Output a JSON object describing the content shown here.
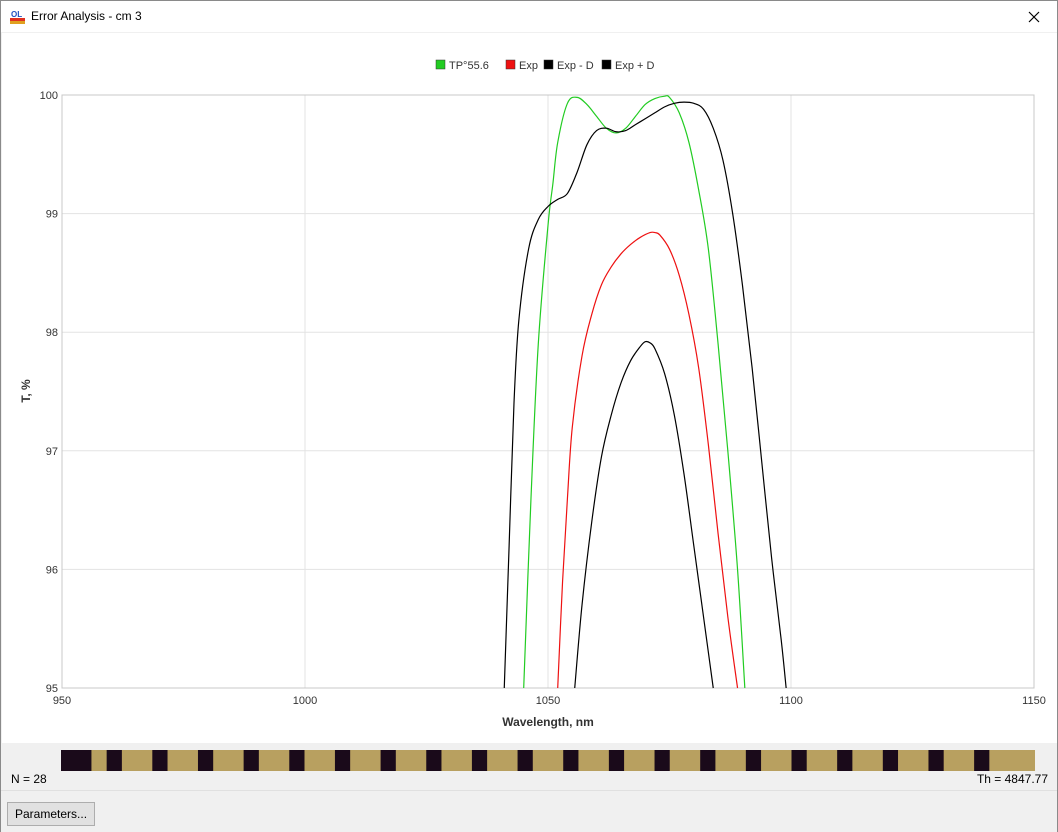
{
  "window": {
    "title": "Error Analysis - cm 3"
  },
  "legend": [
    {
      "label": "TP°55.6",
      "color": "#22cc22"
    },
    {
      "label": "Exp",
      "color": "#ee1111"
    },
    {
      "label": "Exp - D",
      "color": "#000000"
    },
    {
      "label": "Exp + D",
      "color": "#000000"
    }
  ],
  "chart_data": {
    "type": "line",
    "xlabel": "Wavelength, nm",
    "ylabel": "T, %",
    "xlim": [
      950,
      1150
    ],
    "ylim": [
      95,
      100
    ],
    "xticks": [
      950,
      1000,
      1050,
      1100,
      1150
    ],
    "yticks": [
      95,
      96,
      97,
      98,
      99,
      100
    ],
    "grid": true,
    "legend_position": "top-center",
    "series": [
      {
        "name": "TP°55.6",
        "color": "#22cc22",
        "x": [
          1045,
          1046.5,
          1048,
          1050,
          1051,
          1052,
          1054,
          1056,
          1058,
          1060,
          1062,
          1064,
          1066,
          1068,
          1070,
          1072,
          1074,
          1075,
          1077,
          1079,
          1081,
          1083,
          1085,
          1087,
          1089,
          1090.5
        ],
        "y": [
          95.0,
          96.6,
          97.9,
          98.9,
          99.25,
          99.6,
          99.93,
          99.98,
          99.92,
          99.82,
          99.72,
          99.68,
          99.72,
          99.82,
          99.92,
          99.97,
          99.99,
          99.98,
          99.85,
          99.6,
          99.2,
          98.7,
          97.9,
          97.0,
          96.0,
          95.0
        ]
      },
      {
        "name": "Exp",
        "color": "#ee1111",
        "x": [
          1052,
          1053,
          1054,
          1055,
          1057,
          1059,
          1061,
          1063,
          1065,
          1067,
          1069,
          1071,
          1072,
          1073,
          1075,
          1077,
          1079,
          1081,
          1083,
          1085,
          1087,
          1089
        ],
        "y": [
          95.0,
          95.9,
          96.6,
          97.2,
          97.8,
          98.15,
          98.4,
          98.55,
          98.66,
          98.74,
          98.8,
          98.84,
          98.84,
          98.82,
          98.7,
          98.48,
          98.15,
          97.7,
          97.05,
          96.3,
          95.6,
          95.0
        ]
      },
      {
        "name": "Exp - D",
        "color": "#000000",
        "x": [
          1055.5,
          1057,
          1059,
          1061,
          1063,
          1065,
          1067,
          1069,
          1070,
          1071,
          1072,
          1074,
          1076,
          1078,
          1080,
          1082,
          1084
        ],
        "y": [
          95.0,
          95.7,
          96.4,
          96.95,
          97.3,
          97.57,
          97.76,
          97.88,
          97.92,
          97.91,
          97.86,
          97.65,
          97.3,
          96.8,
          96.2,
          95.6,
          95.0
        ]
      },
      {
        "name": "Exp + D",
        "color": "#000000",
        "x": [
          1041,
          1042,
          1043,
          1044,
          1046,
          1048,
          1050,
          1052,
          1054,
          1056,
          1058,
          1060,
          1062,
          1064,
          1066,
          1068,
          1070,
          1072,
          1074,
          1076,
          1078,
          1080,
          1082,
          1084,
          1086,
          1088,
          1090,
          1092,
          1094,
          1096,
          1098,
          1099
        ],
        "y": [
          95.0,
          96.2,
          97.4,
          98.1,
          98.7,
          98.95,
          99.06,
          99.12,
          99.17,
          99.35,
          99.58,
          99.7,
          99.72,
          99.69,
          99.7,
          99.75,
          99.8,
          99.85,
          99.9,
          99.93,
          99.94,
          99.93,
          99.88,
          99.72,
          99.45,
          99.0,
          98.4,
          97.7,
          96.9,
          96.1,
          95.4,
          95.0
        ]
      }
    ]
  },
  "strip": {
    "pattern": [
      "d",
      "d",
      "y",
      "d",
      "y",
      "y",
      "d",
      "y",
      "y",
      "d",
      "y",
      "y",
      "d",
      "y",
      "y",
      "d",
      "y",
      "y",
      "d",
      "y",
      "y",
      "d",
      "y",
      "y",
      "d",
      "y",
      "y",
      "d",
      "y",
      "y",
      "d",
      "y",
      "y",
      "d",
      "y",
      "y",
      "d",
      "y",
      "y",
      "d",
      "y",
      "y",
      "d",
      "y",
      "y",
      "d",
      "y",
      "y",
      "d",
      "y",
      "y",
      "d",
      "y",
      "y",
      "d",
      "y",
      "y",
      "d",
      "y",
      "y",
      "d",
      "y",
      "y",
      "y"
    ],
    "dark_color": "#1a0a1a",
    "light_color": "#b8a060"
  },
  "status": {
    "n": "N = 28",
    "th": "Th = 4847.77"
  },
  "footer": {
    "parameters_label": "Parameters..."
  }
}
